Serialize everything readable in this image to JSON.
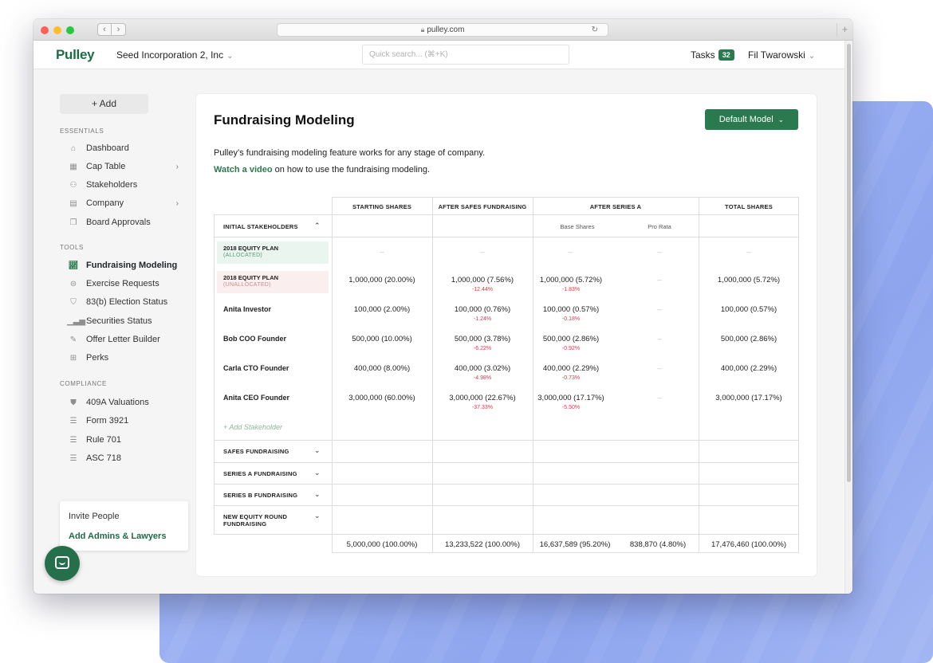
{
  "browser": {
    "url": "pulley.com"
  },
  "header": {
    "logo": "Pulley",
    "company": "Seed Incorporation 2, Inc",
    "search_placeholder": "Quick search... (⌘+K)",
    "tasks_label": "Tasks",
    "tasks_count": "32",
    "user_name": "Fil Twarowski"
  },
  "sidebar": {
    "add_label": "+ Add",
    "essentials_title": "ESSENTIALS",
    "essentials": [
      {
        "label": "Dashboard",
        "icon": "home-icon",
        "has_arrow": false
      },
      {
        "label": "Cap Table",
        "icon": "table-icon",
        "has_arrow": true
      },
      {
        "label": "Stakeholders",
        "icon": "people-icon",
        "has_arrow": false
      },
      {
        "label": "Company",
        "icon": "building-icon",
        "has_arrow": true
      },
      {
        "label": "Board Approvals",
        "icon": "documents-icon",
        "has_arrow": false
      }
    ],
    "tools_title": "TOOLS",
    "tools": [
      {
        "label": "Fundraising Modeling",
        "icon": "chart-icon",
        "active": true
      },
      {
        "label": "Exercise Requests",
        "icon": "dollar-icon",
        "active": false
      },
      {
        "label": "83(b) Election Status",
        "icon": "badge-icon",
        "active": false
      },
      {
        "label": "Securities Status",
        "icon": "bars-icon",
        "active": false
      },
      {
        "label": "Offer Letter Builder",
        "icon": "pen-icon",
        "active": false
      },
      {
        "label": "Perks",
        "icon": "gift-icon",
        "active": false
      }
    ],
    "compliance_title": "COMPLIANCE",
    "compliance": [
      {
        "label": "409A Valuations",
        "icon": "shield-icon"
      },
      {
        "label": "Form 3921",
        "icon": "form-icon"
      },
      {
        "label": "Rule 701",
        "icon": "form-icon"
      },
      {
        "label": "ASC 718",
        "icon": "form-icon"
      }
    ],
    "invite_people": "Invite People",
    "add_admins": "Add Admins & Lawyers"
  },
  "main": {
    "title": "Fundraising Modeling",
    "model_button": "Default Model",
    "description": "Pulley’s fundraising modeling feature works for any stage of company.",
    "video_link": "Watch a video",
    "video_rest": " on how to use the fundraising modeling."
  },
  "table": {
    "columns": {
      "starting": "STARTING SHARES",
      "safes": "AFTER SAFES FUNDRAISING",
      "series_a": "AFTER SERIES A",
      "total": "TOTAL SHARES",
      "base": "Base Shares",
      "prorata": "Pro Rata"
    },
    "initial_label": "INITIAL STAKEHOLDERS",
    "dash": "–",
    "plan_allocated": {
      "name": "2018 EQUITY PLAN",
      "sub": "(ALLOCATED)"
    },
    "plan_unallocated": {
      "name": "2018 EQUITY PLAN",
      "sub": "(UNALLOCATED)",
      "starting": "1,000,000 (20.00%)",
      "safes": "1,000,000 (7.56%)",
      "safes_delta": "-12.44%",
      "base": "1,000,000 (5.72%)",
      "base_delta": "-1.83%",
      "total": "1,000,000 (5.72%)"
    },
    "rows": [
      {
        "name": "Anita Investor",
        "starting": "100,000 (2.00%)",
        "safes": "100,000 (0.76%)",
        "safes_delta": "-1.24%",
        "base": "100,000 (0.57%)",
        "base_delta": "-0.18%",
        "total": "100,000 (0.57%)"
      },
      {
        "name": "Bob COO Founder",
        "starting": "500,000 (10.00%)",
        "safes": "500,000 (3.78%)",
        "safes_delta": "-6.22%",
        "base": "500,000 (2.86%)",
        "base_delta": "-0.92%",
        "total": "500,000 (2.86%)"
      },
      {
        "name": "Carla CTO Founder",
        "starting": "400,000 (8.00%)",
        "safes": "400,000 (3.02%)",
        "safes_delta": "-4.98%",
        "base": "400,000 (2.29%)",
        "base_delta": "-0.73%",
        "total": "400,000 (2.29%)"
      },
      {
        "name": "Anita CEO Founder",
        "starting": "3,000,000 (60.00%)",
        "safes": "3,000,000 (22.67%)",
        "safes_delta": "-37.33%",
        "base": "3,000,000 (17.17%)",
        "base_delta": "-5.50%",
        "total": "3,000,000 (17.17%)"
      }
    ],
    "add_stakeholder": "+ Add Stakeholder",
    "sections": {
      "safes": "SAFES FUNDRAISING",
      "series_a": "SERIES A FUNDRAISING",
      "series_b": "SERIES B FUNDRAISING",
      "new_equity_1": "NEW EQUITY ROUND",
      "new_equity_2": "FUNDRAISING"
    },
    "totals": {
      "starting": "5,000,000 (100.00%)",
      "safes": "13,233,522 (100.00%)",
      "base": "16,637,589 (95.20%)",
      "prorata": "838,870 (4.80%)",
      "total": "17,476,460 (100.00%)"
    }
  }
}
